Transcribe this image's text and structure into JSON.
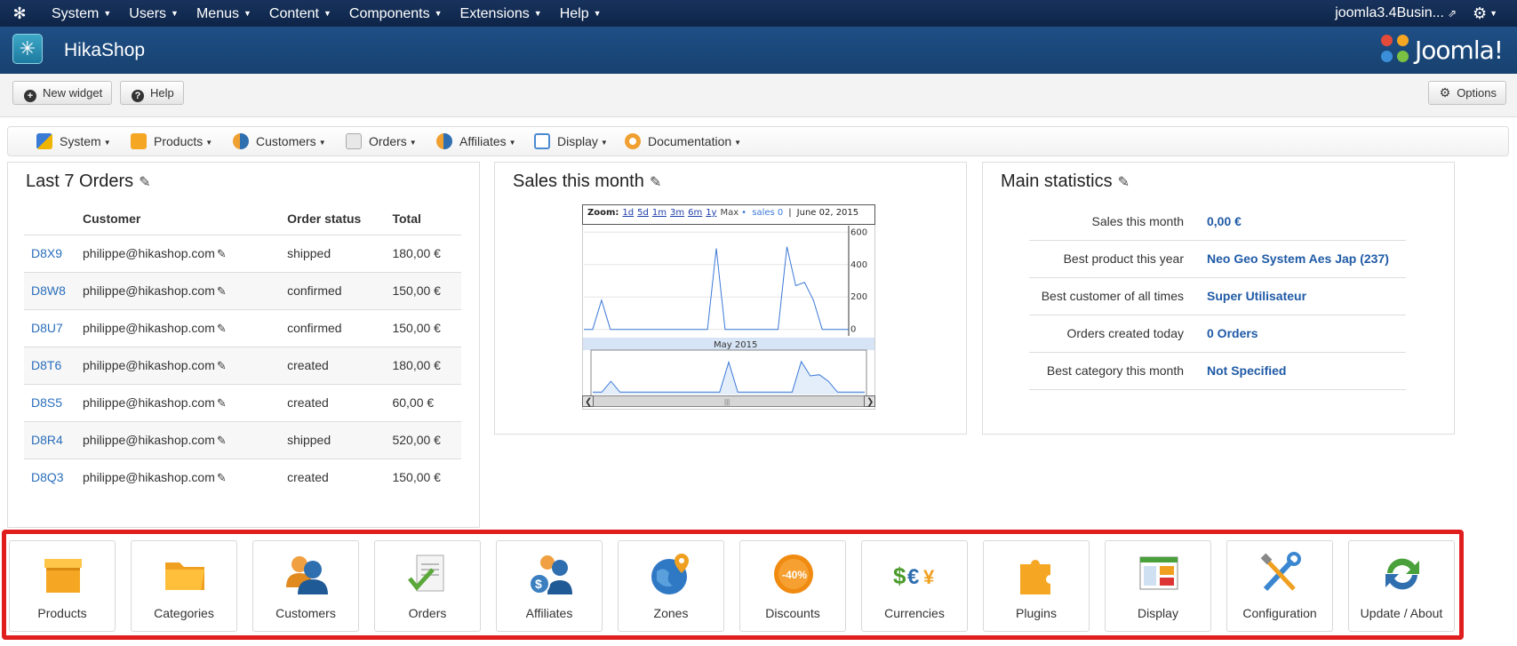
{
  "topbar": {
    "menu": [
      "System",
      "Users",
      "Menus",
      "Content",
      "Components",
      "Extensions",
      "Help"
    ],
    "site_name": "joomla3.4Busin..."
  },
  "header": {
    "title": "HikaShop",
    "brand": "Joomla!"
  },
  "toolbar": {
    "new_widget": "New widget",
    "help": "Help",
    "options": "Options"
  },
  "submenu": [
    "System",
    "Products",
    "Customers",
    "Orders",
    "Affiliates",
    "Display",
    "Documentation"
  ],
  "orders_panel": {
    "title": "Last 7 Orders",
    "columns": [
      "Customer",
      "Order status",
      "Total"
    ],
    "rows": [
      {
        "id": "D8X9",
        "customer": "philippe@hikashop.com",
        "status": "shipped",
        "total": "180,00 €"
      },
      {
        "id": "D8W8",
        "customer": "philippe@hikashop.com",
        "status": "confirmed",
        "total": "150,00 €"
      },
      {
        "id": "D8U7",
        "customer": "philippe@hikashop.com",
        "status": "confirmed",
        "total": "150,00 €"
      },
      {
        "id": "D8T6",
        "customer": "philippe@hikashop.com",
        "status": "created",
        "total": "180,00 €"
      },
      {
        "id": "D8S5",
        "customer": "philippe@hikashop.com",
        "status": "created",
        "total": "60,00 €"
      },
      {
        "id": "D8R4",
        "customer": "philippe@hikashop.com",
        "status": "shipped",
        "total": "520,00 €"
      },
      {
        "id": "D8Q3",
        "customer": "philippe@hikashop.com",
        "status": "created",
        "total": "150,00 €"
      }
    ]
  },
  "sales_panel": {
    "title": "Sales this month",
    "zoom_label": "Zoom:",
    "zoom_options": [
      "1d",
      "5d",
      "1m",
      "3m",
      "6m",
      "1y"
    ],
    "max_label": "Max",
    "legend": "sales 0",
    "date": "June 02, 2015",
    "month_label": "May 2015"
  },
  "chart_data": {
    "type": "line",
    "title": "",
    "y_ticks": [
      0,
      200,
      400,
      600
    ],
    "ylim": [
      -40,
      640
    ],
    "series": [
      {
        "values": [
          0,
          0,
          180,
          0,
          0,
          0,
          0,
          0,
          0,
          0,
          0,
          0,
          0,
          0,
          0,
          500,
          0,
          0,
          0,
          0,
          0,
          0,
          0,
          510,
          270,
          290,
          180,
          0,
          0,
          0,
          0
        ]
      }
    ]
  },
  "stats_panel": {
    "title": "Main statistics",
    "rows": [
      {
        "label": "Sales this month",
        "value": "0,00 €"
      },
      {
        "label": "Best product this year",
        "value": "Neo Geo System Aes Jap (237)"
      },
      {
        "label": "Best customer of all times",
        "value": "Super Utilisateur"
      },
      {
        "label": "Orders created today",
        "value": "0 Orders"
      },
      {
        "label": "Best category this month",
        "value": "Not Specified"
      }
    ]
  },
  "shortcuts": [
    {
      "label": "Products",
      "icon": "box-icon"
    },
    {
      "label": "Categories",
      "icon": "folder-icon"
    },
    {
      "label": "Customers",
      "icon": "users-icon"
    },
    {
      "label": "Orders",
      "icon": "document-check-icon"
    },
    {
      "label": "Affiliates",
      "icon": "affiliates-icon"
    },
    {
      "label": "Zones",
      "icon": "globe-icon"
    },
    {
      "label": "Discounts",
      "icon": "discount-badge-icon"
    },
    {
      "label": "Currencies",
      "icon": "currencies-icon"
    },
    {
      "label": "Plugins",
      "icon": "puzzle-icon"
    },
    {
      "label": "Display",
      "icon": "display-window-icon"
    },
    {
      "label": "Configuration",
      "icon": "tools-icon"
    },
    {
      "label": "Update / About",
      "icon": "update-icon"
    }
  ],
  "colors": {
    "topbar": "#0f2a50",
    "header": "#1f4f86",
    "link": "#2a6ebb",
    "highlight_border": "#e01e1e",
    "series": "#3b78d8"
  }
}
